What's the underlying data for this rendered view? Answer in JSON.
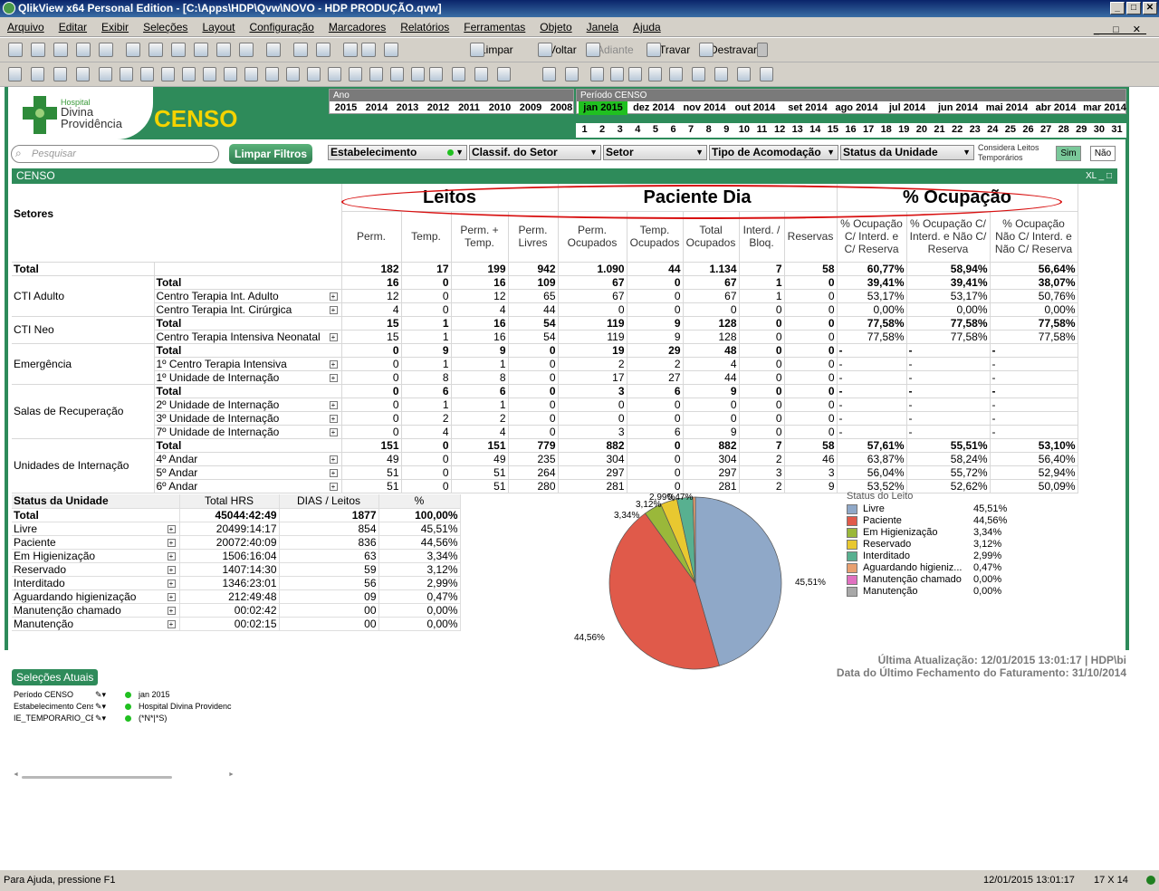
{
  "window": {
    "title": "QlikView x64 Personal Edition - [C:\\Apps\\HDP\\Qvw\\NOVO - HDP PRODUÇÃO.qvw]"
  },
  "menu": [
    "Arquivo",
    "Editar",
    "Exibir",
    "Seleções",
    "Layout",
    "Configuração",
    "Marcadores",
    "Relatórios",
    "Ferramentas",
    "Objeto",
    "Janela",
    "Ajuda"
  ],
  "toolbar": {
    "limpar": "Limpar",
    "voltar": "Voltar",
    "adiante": "Adiante",
    "travar": "Travar",
    "destravar": "Destravar"
  },
  "header": {
    "logo_small": "Hospital",
    "logo_l1": "Divina",
    "logo_l2": "Providência",
    "title": "CENSO"
  },
  "ano": {
    "label": "Ano",
    "values": [
      "2015",
      "2014",
      "2013",
      "2012",
      "2011",
      "2010",
      "2009",
      "2008"
    ]
  },
  "periodo": {
    "label": "Período CENSO",
    "values": [
      "jan 2015",
      "dez 2014",
      "nov 2014",
      "out 2014",
      "set 2014",
      "ago 2014",
      "jul 2014",
      "jun 2014",
      "mai 2014",
      "abr 2014",
      "mar 2014"
    ],
    "selected": "jan 2015"
  },
  "dias": [
    "1",
    "2",
    "3",
    "4",
    "5",
    "6",
    "7",
    "8",
    "9",
    "10",
    "11",
    "12",
    "13",
    "14",
    "15",
    "16",
    "17",
    "18",
    "19",
    "20",
    "21",
    "22",
    "23",
    "24",
    "25",
    "26",
    "27",
    "28",
    "29",
    "30",
    "31"
  ],
  "search": {
    "placeholder": "Pesquisar"
  },
  "limpar_filtros": "Limpar Filtros",
  "filters": [
    "Estabelecimento",
    "Classif. do Setor",
    "Setor",
    "Tipo de Acomodação",
    "Status da Unidade"
  ],
  "considera": {
    "label_l1": "Considera Leitos",
    "label_l2": "Temporários",
    "sim": "Sim",
    "nao": "Não"
  },
  "censo_object": {
    "caption": "CENSO",
    "icons": "XL _ □"
  },
  "pivot": {
    "groups": [
      "Leitos",
      "Paciente Dia",
      "% Ocupação"
    ],
    "setores_label": "Setores",
    "columns": [
      "Perm.",
      "Temp.",
      "Perm. + Temp.",
      "Perm. Livres",
      "Perm. Ocupados",
      "Temp. Ocupados",
      "Total Ocupados",
      "Interd. / Bloq.",
      "Reservas",
      "% Ocupação C/ Interd. e C/ Reserva",
      "% Ocupação C/ Interd. e Não C/ Reserva",
      "% Ocupação Não C/ Interd. e Não C/ Reserva"
    ],
    "total_row": {
      "label": "Total",
      "values": [
        "182",
        "17",
        "199",
        "942",
        "1.090",
        "44",
        "1.134",
        "7",
        "58",
        "60,77%",
        "58,94%",
        "56,64%"
      ]
    },
    "sectors": [
      {
        "name": "CTI Adulto",
        "rows": [
          {
            "label": "Total",
            "bold": true,
            "values": [
              "16",
              "0",
              "16",
              "109",
              "67",
              "0",
              "67",
              "1",
              "0",
              "39,41%",
              "39,41%",
              "38,07%"
            ]
          },
          {
            "label": "Centro Terapia Int. Adulto",
            "values": [
              "12",
              "0",
              "12",
              "65",
              "67",
              "0",
              "67",
              "1",
              "0",
              "53,17%",
              "53,17%",
              "50,76%"
            ]
          },
          {
            "label": "Centro Terapia Int. Cirúrgica",
            "values": [
              "4",
              "0",
              "4",
              "44",
              "0",
              "0",
              "0",
              "0",
              "0",
              "0,00%",
              "0,00%",
              "0,00%"
            ]
          }
        ]
      },
      {
        "name": "CTI Neo",
        "rows": [
          {
            "label": "Total",
            "bold": true,
            "values": [
              "15",
              "1",
              "16",
              "54",
              "119",
              "9",
              "128",
              "0",
              "0",
              "77,58%",
              "77,58%",
              "77,58%"
            ]
          },
          {
            "label": "Centro Terapia Intensiva Neonatal",
            "values": [
              "15",
              "1",
              "16",
              "54",
              "119",
              "9",
              "128",
              "0",
              "0",
              "77,58%",
              "77,58%",
              "77,58%"
            ]
          }
        ]
      },
      {
        "name": "Emergência",
        "rows": [
          {
            "label": "Total",
            "bold": true,
            "values": [
              "0",
              "9",
              "9",
              "0",
              "19",
              "29",
              "48",
              "0",
              "0",
              "-",
              "-",
              "-"
            ]
          },
          {
            "label": "1º Centro Terapia Intensiva",
            "values": [
              "0",
              "1",
              "1",
              "0",
              "2",
              "2",
              "4",
              "0",
              "0",
              "-",
              "-",
              "-"
            ]
          },
          {
            "label": "1º Unidade de Internação",
            "values": [
              "0",
              "8",
              "8",
              "0",
              "17",
              "27",
              "44",
              "0",
              "0",
              "-",
              "-",
              "-"
            ]
          }
        ]
      },
      {
        "name": "Salas de Recuperação",
        "rows": [
          {
            "label": "Total",
            "bold": true,
            "values": [
              "0",
              "6",
              "6",
              "0",
              "3",
              "6",
              "9",
              "0",
              "0",
              "-",
              "-",
              "-"
            ]
          },
          {
            "label": "2º Unidade de Internação",
            "values": [
              "0",
              "1",
              "1",
              "0",
              "0",
              "0",
              "0",
              "0",
              "0",
              "-",
              "-",
              "-"
            ]
          },
          {
            "label": "3º Unidade de Internação",
            "values": [
              "0",
              "2",
              "2",
              "0",
              "0",
              "0",
              "0",
              "0",
              "0",
              "-",
              "-",
              "-"
            ]
          },
          {
            "label": "7º Unidade de Internação",
            "values": [
              "0",
              "4",
              "4",
              "0",
              "3",
              "6",
              "9",
              "0",
              "0",
              "-",
              "-",
              "-"
            ]
          }
        ]
      },
      {
        "name": "Unidades de Internação",
        "rows": [
          {
            "label": "Total",
            "bold": true,
            "values": [
              "151",
              "0",
              "151",
              "779",
              "882",
              "0",
              "882",
              "7",
              "58",
              "57,61%",
              "55,51%",
              "53,10%"
            ]
          },
          {
            "label": "4º Andar",
            "values": [
              "49",
              "0",
              "49",
              "235",
              "304",
              "0",
              "304",
              "2",
              "46",
              "63,87%",
              "58,24%",
              "56,40%"
            ]
          },
          {
            "label": "5º Andar",
            "values": [
              "51",
              "0",
              "51",
              "264",
              "297",
              "0",
              "297",
              "3",
              "3",
              "56,04%",
              "55,72%",
              "52,94%"
            ]
          },
          {
            "label": "6º Andar",
            "values": [
              "51",
              "0",
              "51",
              "280",
              "281",
              "0",
              "281",
              "2",
              "9",
              "53,52%",
              "52,62%",
              "50,09%"
            ]
          }
        ]
      }
    ]
  },
  "status_table": {
    "headers": [
      "Status da Unidade",
      "Total HRS",
      "DIAS / Leitos",
      "%"
    ],
    "total": [
      "Total",
      "45044:42:49",
      "1877",
      "100,00%"
    ],
    "rows": [
      [
        "Livre",
        "20499:14:17",
        "854",
        "45,51%"
      ],
      [
        "Paciente",
        "20072:40:09",
        "836",
        "44,56%"
      ],
      [
        "Em Higienização",
        "1506:16:04",
        "63",
        "3,34%"
      ],
      [
        "Reservado",
        "1407:14:30",
        "59",
        "3,12%"
      ],
      [
        "Interditado",
        "1346:23:01",
        "56",
        "2,99%"
      ],
      [
        "Aguardando higienização",
        "212:49:48",
        "09",
        "0,47%"
      ],
      [
        "Manutenção chamado",
        "00:02:42",
        "00",
        "0,00%"
      ],
      [
        "Manutenção",
        "00:02:15",
        "00",
        "0,00%"
      ]
    ]
  },
  "chart_data": {
    "type": "pie",
    "title": "",
    "legend_title": "Status do Leito",
    "categories": [
      "Livre",
      "Paciente",
      "Em Higienização",
      "Reservado",
      "Interditado",
      "Aguardando higieniz...",
      "Manutenção chamado",
      "Manutenção"
    ],
    "values": [
      45.51,
      44.56,
      3.34,
      3.12,
      2.99,
      0.47,
      0.0,
      0.0
    ],
    "value_labels": [
      "45,51%",
      "44,56%",
      "3,34%",
      "3,12%",
      "2,99%",
      "0,47%",
      "0,00%",
      "0,00%"
    ],
    "colors": [
      "#8fa8c8",
      "#e05a4a",
      "#9ab83a",
      "#e8c830",
      "#58b090",
      "#e8a070",
      "#e070c0",
      "#a8a8a8"
    ],
    "legend": "right"
  },
  "update_info": {
    "l1": "Última Atualização: 12/01/2015 13:01:17 | HDP\\bi",
    "l2": "Data do Último Fechamento do Faturamento: 31/10/2014"
  },
  "selecoes": {
    "title": "Seleções Atuais",
    "rows": [
      [
        "Período CENSO",
        "jan 2015"
      ],
      [
        "Estabelecimento Cens",
        "Hospital Divina Providenc"
      ],
      [
        "IE_TEMPORARIO_CE",
        "(*N*|*S)"
      ]
    ]
  },
  "statusbar": {
    "help": "Para Ajuda, pressione F1",
    "datetime": "12/01/2015 13:01:17",
    "size": "17 X 14"
  }
}
